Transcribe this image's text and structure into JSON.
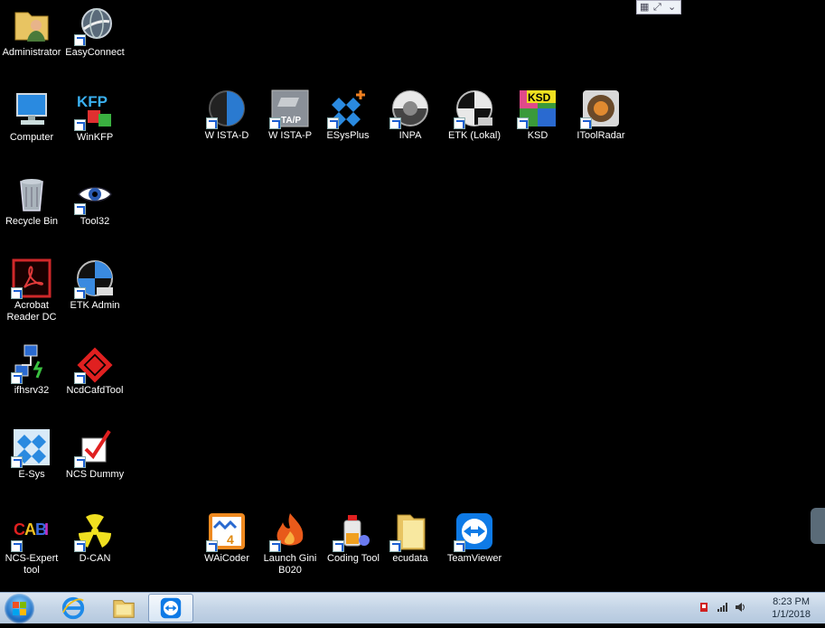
{
  "desktop": {
    "icons": [
      {
        "label": "Administrator",
        "icon": "folder-user-icon"
      },
      {
        "label": "EasyConnect",
        "icon": "globe-icon"
      },
      {
        "label": "Computer",
        "icon": "computer-icon"
      },
      {
        "label": "WinKFP",
        "icon": "kfp-icon"
      },
      {
        "label": "Recycle Bin",
        "icon": "recycle-bin-icon"
      },
      {
        "label": "Tool32",
        "icon": "eye-icon"
      },
      {
        "label": "Acrobat Reader DC",
        "icon": "acrobat-icon"
      },
      {
        "label": "ETK Admin",
        "icon": "etk-admin-icon"
      },
      {
        "label": "ifhsrv32",
        "icon": "network-icon"
      },
      {
        "label": "NcdCafdTool",
        "icon": "ncd-icon"
      },
      {
        "label": "E-Sys",
        "icon": "esys-icon"
      },
      {
        "label": "NCS Dummy",
        "icon": "checkmark-icon"
      },
      {
        "label": "NCS-Expert tool",
        "icon": "ncs-expert-icon"
      },
      {
        "label": "D-CAN",
        "icon": "radiation-icon"
      },
      {
        "label": "W ISTA-D",
        "icon": "ista-d-icon"
      },
      {
        "label": "W ISTA-P",
        "icon": "ista-p-icon"
      },
      {
        "label": "ESysPlus",
        "icon": "esysplus-icon"
      },
      {
        "label": "INPA",
        "icon": "inpa-icon"
      },
      {
        "label": "ETK (Lokal)",
        "icon": "etk-icon"
      },
      {
        "label": "KSD",
        "icon": "ksd-icon"
      },
      {
        "label": "IToolRadar",
        "icon": "radar-icon"
      },
      {
        "label": "WAiCoder",
        "icon": "coder-icon"
      },
      {
        "label": "Launch Gini B020",
        "icon": "flame-icon"
      },
      {
        "label": "Coding Tool",
        "icon": "coding-tool-icon"
      },
      {
        "label": "ecudata",
        "icon": "folder-icon"
      },
      {
        "label": "TeamViewer",
        "icon": "teamviewer-icon"
      }
    ]
  },
  "taskbar": {
    "buttons": [
      {
        "name": "start-button",
        "icon": "windows-orb-icon"
      },
      {
        "name": "internet-explorer",
        "icon": "internet-explorer-icon"
      },
      {
        "name": "file-explorer",
        "icon": "folder-icon"
      },
      {
        "name": "teamviewer",
        "icon": "teamviewer-icon",
        "active": true
      }
    ]
  },
  "tray": {
    "time": "8:23 PM",
    "date": "1/1/2018",
    "icons": [
      "usb-device-icon",
      "network-signal-icon",
      "volume-icon"
    ]
  },
  "colors": {
    "desktop_bg": "#000000",
    "taskbar": "#c4d4e6",
    "accent_blue": "#1b5fd1"
  }
}
